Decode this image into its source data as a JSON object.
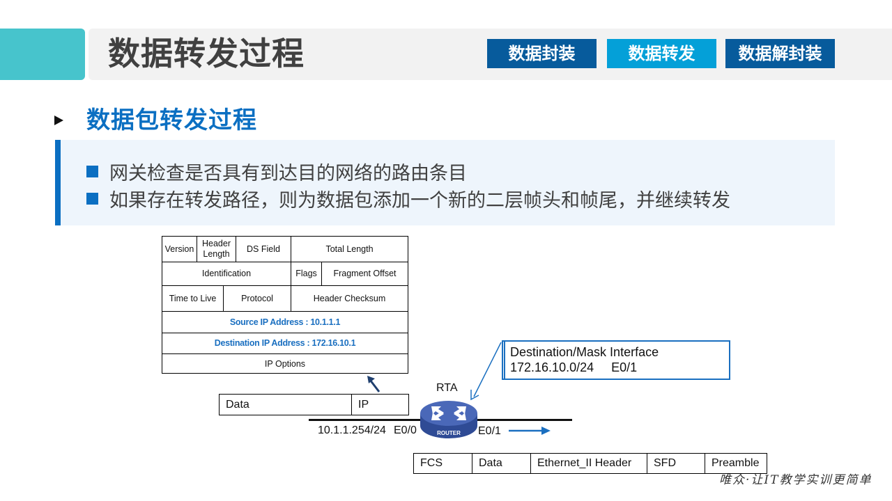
{
  "header": {
    "title": "数据转发过程",
    "tabs": [
      {
        "label": "数据封装",
        "active": false
      },
      {
        "label": "数据转发",
        "active": true
      },
      {
        "label": "数据解封装",
        "active": false
      }
    ]
  },
  "section": {
    "title": "数据包转发过程",
    "bullets": [
      "网关检查是否具有到达目的网络的路由条目",
      "如果存在转发路径，则为数据包添加一个新的二层帧头和帧尾，并继续转发"
    ]
  },
  "ip_header": {
    "row1": {
      "version": "Version",
      "header_length_1": "Header",
      "header_length_2": "Length",
      "ds_field": "DS Field",
      "total_length": "Total Length"
    },
    "row2": {
      "identification": "Identification",
      "flags": "Flags",
      "fragment_offset": "Fragment Offset"
    },
    "row3": {
      "ttl": "Time to Live",
      "protocol": "Protocol",
      "checksum": "Header Checksum"
    },
    "source": "Source IP Address : 10.1.1.1",
    "destination": "Destination IP Address :  172.16.10.1",
    "options": "IP  Options"
  },
  "packet": {
    "data": "Data",
    "ip": "IP"
  },
  "router": {
    "name": "RTA",
    "badge": "ROUTER",
    "ingress_ip": "10.1.1.254/24",
    "ingress_if": "E0/0",
    "egress_if": "E0/1"
  },
  "route_table": {
    "header": "Destination/Mask Interface",
    "entry": "172.16.10.0/24     E0/1"
  },
  "ethernet_frame": [
    "FCS",
    "Data",
    "Ethernet_II  Header",
    "SFD",
    "Preamble"
  ],
  "colors": {
    "teal": "#47c4cc",
    "tab_dark": "#075b9c",
    "tab_active": "#04a0d8",
    "accent_blue": "#0b6fc2",
    "panel_bg": "#eef5fc",
    "router_blue": "#3d5bab"
  },
  "watermark": "唯众·让IT教学实训更简单"
}
